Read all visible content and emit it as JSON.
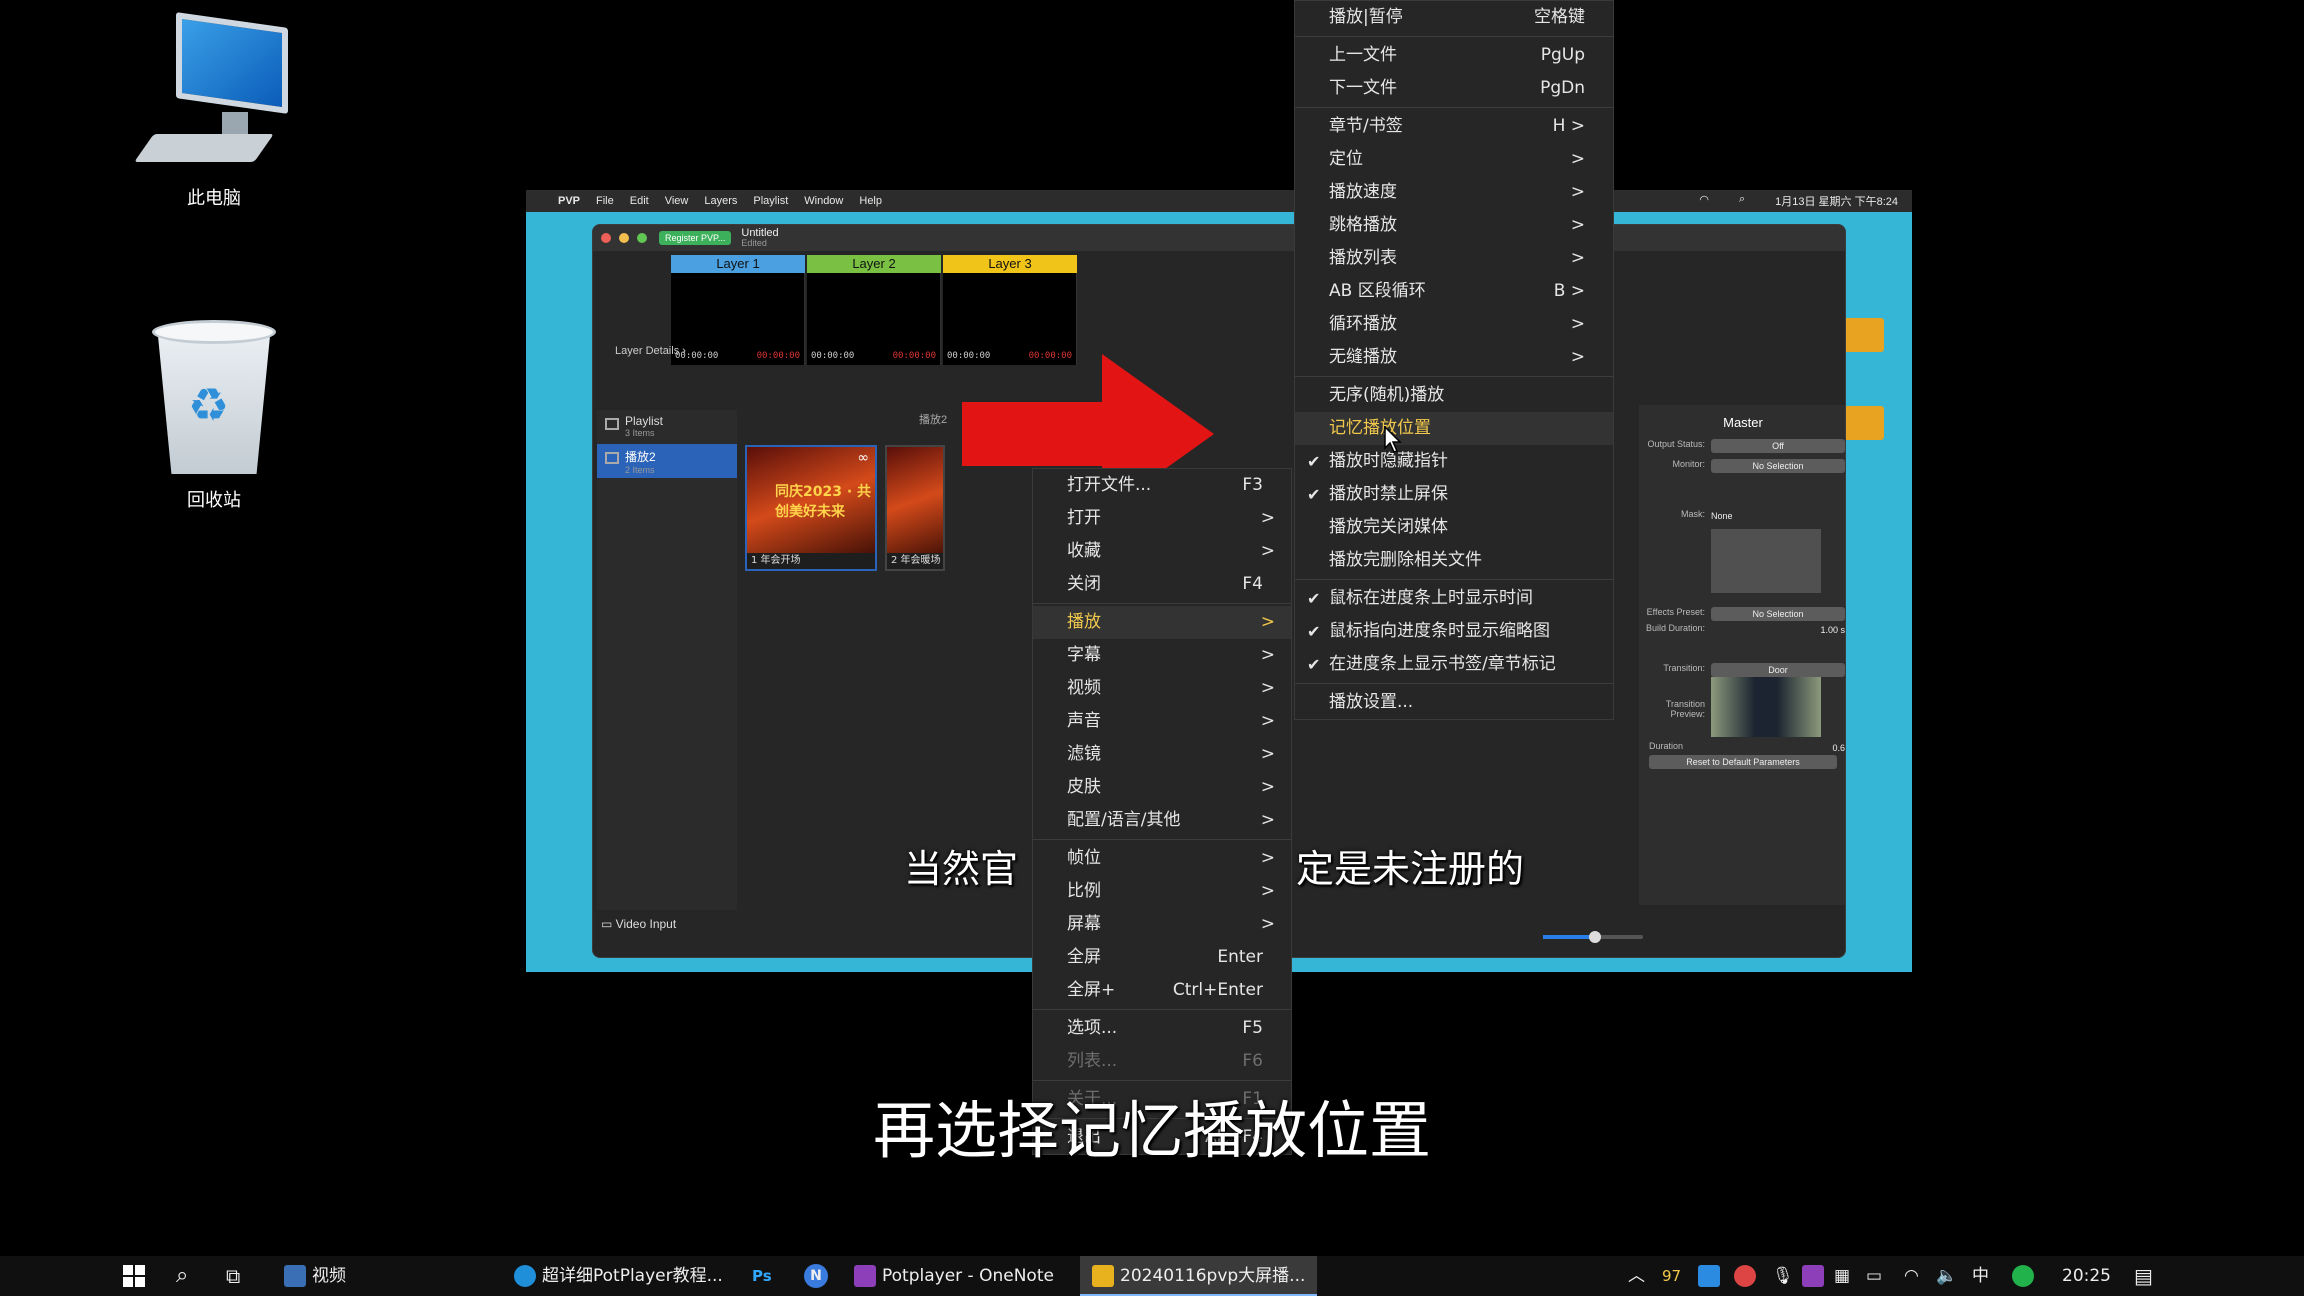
{
  "desktop": {
    "icons": [
      {
        "label": "此电脑"
      },
      {
        "label": "回收站"
      }
    ]
  },
  "video": {
    "mac_menubar": {
      "app": "PVP",
      "items": [
        "File",
        "Edit",
        "View",
        "Layers",
        "Playlist",
        "Window",
        "Help"
      ],
      "clock": "1月13日 星期六 下午8:24"
    },
    "window": {
      "register_button": "Register PVP...",
      "title": "Untitled",
      "subtitle": "Edited",
      "layers": [
        {
          "label": "Layer 1",
          "color": "#4aa0e0",
          "tc_left": "00:00:00",
          "tc_right": "00:00:00"
        },
        {
          "label": "Layer 2",
          "color": "#7ac143",
          "tc_left": "00:00:00",
          "tc_right": "00:00:00"
        },
        {
          "label": "Layer 3",
          "color": "#f0c419",
          "tc_left": "00:00:00",
          "tc_right": "00:00:00"
        }
      ],
      "layer_details": "Layer Details",
      "playlist_header": "播放2",
      "sidebar": [
        {
          "label": "Playlist",
          "sub": "3 Items"
        },
        {
          "label": "播放2",
          "sub": "2 Items"
        }
      ],
      "video_input": "Video Input",
      "thumbs": [
        {
          "caption": "1  年会开场",
          "banner": "同庆2023 · 共创美好未来"
        },
        {
          "caption": "2  年会暖场",
          "banner": ""
        }
      ],
      "right_panel": {
        "master": "Master",
        "output_status_label": "Output Status:",
        "output_status": "Off",
        "monitor_label": "Monitor:",
        "monitor": "No Selection",
        "mask_label": "Mask:",
        "mask": "None",
        "effects_preset_label": "Effects Preset:",
        "effects_preset": "No Selection",
        "fade_duration_label": "Build Duration:",
        "fade_duration": "1.00 s",
        "transition_label": "Transition:",
        "transition": "Door",
        "transition_preview_label": "Transition Preview:",
        "duration_label": "Duration",
        "duration": "0.6",
        "reset": "Reset to Default Parameters"
      }
    }
  },
  "context_menu": {
    "items": [
      {
        "label": "打开文件...",
        "shortcut": "F3"
      },
      {
        "label": "打开",
        "arrow": ">"
      },
      {
        "label": "收藏",
        "arrow": ">"
      },
      {
        "label": "关闭",
        "shortcut": "F4"
      },
      {
        "label": "播放",
        "arrow": ">",
        "highlight": true
      },
      {
        "label": "字幕",
        "arrow": ">"
      },
      {
        "label": "视频",
        "arrow": ">"
      },
      {
        "label": "声音",
        "arrow": ">"
      },
      {
        "label": "滤镜",
        "arrow": ">"
      },
      {
        "label": "皮肤",
        "arrow": ">"
      },
      {
        "label": "配置/语言/其他",
        "arrow": ">"
      },
      {
        "label": "帧位",
        "arrow": ">"
      },
      {
        "label": "比例",
        "arrow": ">"
      },
      {
        "label": "屏幕",
        "arrow": ">"
      },
      {
        "label": "全屏",
        "shortcut": "Enter"
      },
      {
        "label": "全屏+",
        "shortcut": "Ctrl+Enter"
      },
      {
        "label": "选项...",
        "shortcut": "F5"
      },
      {
        "label": "列表...",
        "shortcut": "F6"
      },
      {
        "label": "关于...",
        "shortcut": "F1"
      },
      {
        "label": "退出",
        "shortcut": "Alt+F4"
      }
    ]
  },
  "play_submenu": {
    "items": [
      {
        "label": "播放|暂停",
        "shortcut": "空格键"
      },
      {
        "label": "上一文件",
        "shortcut": "PgUp"
      },
      {
        "label": "下一文件",
        "shortcut": "PgDn"
      },
      {
        "label": "章节/书签",
        "shortcut": "H >"
      },
      {
        "label": "定位",
        "shortcut": ">"
      },
      {
        "label": "播放速度",
        "shortcut": ">"
      },
      {
        "label": "跳格播放",
        "shortcut": ">"
      },
      {
        "label": "播放列表",
        "shortcut": ">"
      },
      {
        "label": "AB 区段循环",
        "shortcut": "B >"
      },
      {
        "label": "循环播放",
        "shortcut": ">"
      },
      {
        "label": "无缝播放",
        "shortcut": ">"
      },
      {
        "label": "无序(随机)播放"
      },
      {
        "label": "记忆播放位置",
        "highlight": true
      },
      {
        "label": "播放时隐藏指针",
        "checked": "✔"
      },
      {
        "label": "播放时禁止屏保",
        "checked": "✔"
      },
      {
        "label": "播放完关闭媒体"
      },
      {
        "label": "播放完删除相关文件"
      },
      {
        "label": "鼠标在进度条上时显示时间",
        "checked": "✔"
      },
      {
        "label": "鼠标指向进度条时显示缩略图",
        "checked": "✔"
      },
      {
        "label": "在进度条上显示书签/章节标记",
        "checked": "✔"
      },
      {
        "label": "播放设置..."
      }
    ]
  },
  "subtitles": {
    "video_subtitle_left": "当然官",
    "video_subtitle_right": "定是未注册的",
    "main": "再选择记忆播放位置"
  },
  "taskbar": {
    "items": [
      {
        "label": "视频"
      },
      {
        "label": "超详细PotPlayer教程..."
      },
      {
        "label": "Ps"
      },
      {
        "label": "N"
      },
      {
        "label": "Potplayer - OneNote"
      },
      {
        "label": "20240116pvp大屏播..."
      }
    ],
    "tray": {
      "num": "97",
      "ime": "中",
      "time": "20:25"
    }
  }
}
